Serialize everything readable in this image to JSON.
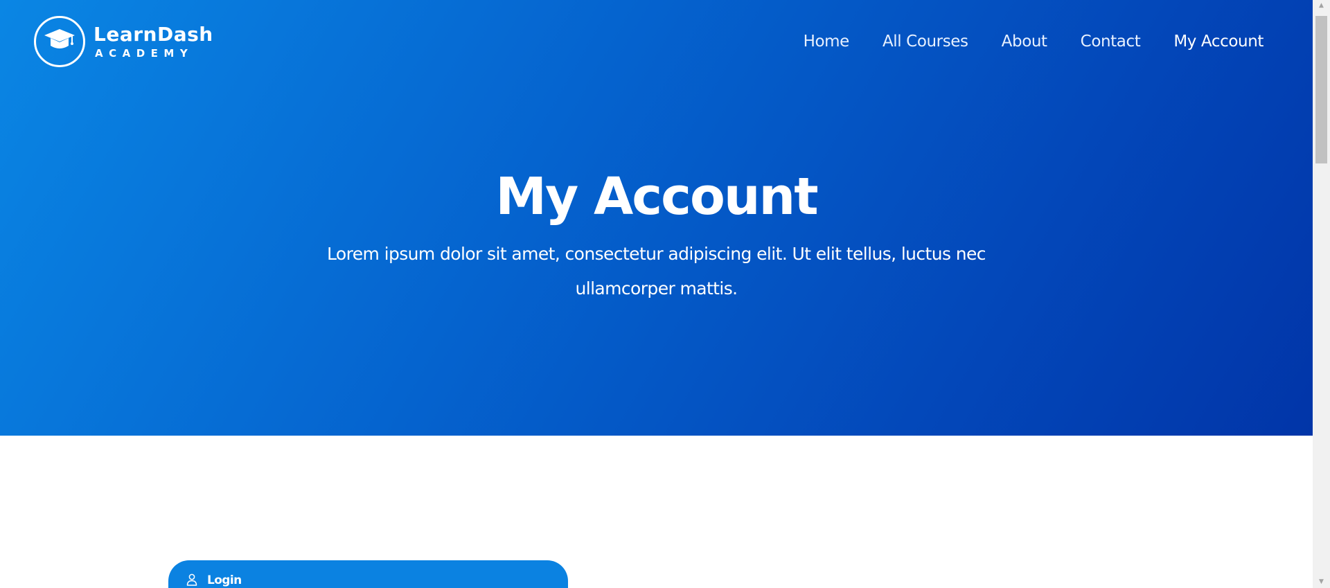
{
  "brand": {
    "name": "LearnDash",
    "tagline": "ACADEMY",
    "icon": "graduation-cap-icon"
  },
  "nav": {
    "items": [
      {
        "label": "Home"
      },
      {
        "label": "All Courses"
      },
      {
        "label": "About"
      },
      {
        "label": "Contact"
      },
      {
        "label": "My Account"
      }
    ],
    "active": "My Account"
  },
  "hero": {
    "title": "My Account",
    "description": "Lorem ipsum dolor sit amet, consectetur adipiscing elit. Ut elit tellus, luctus nec ullamcorper mattis."
  },
  "login_tab": {
    "label": "Login",
    "icon": "user-icon"
  },
  "colors": {
    "hero_gradient_start": "#0a86e4",
    "hero_gradient_end": "#0135a8",
    "accent": "#0b82e1",
    "text_on_accent": "#ffffff"
  }
}
